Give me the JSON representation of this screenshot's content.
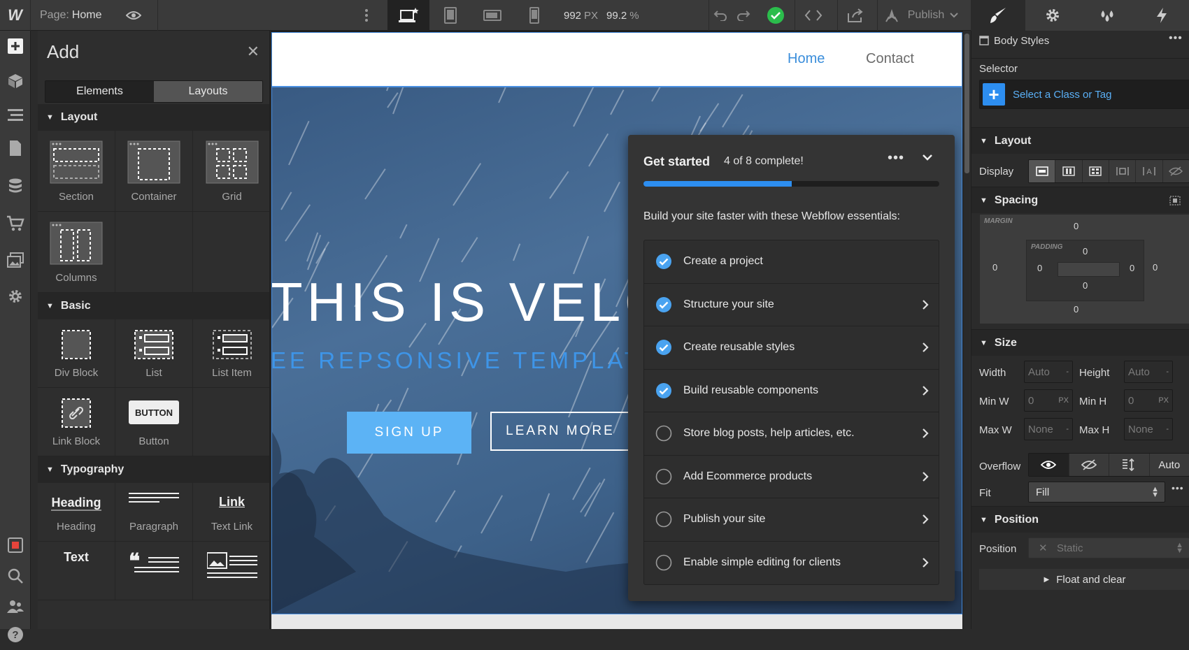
{
  "topbar": {
    "page_prefix": "Page:",
    "page_name": "Home",
    "px_value": "992",
    "px_unit": "PX",
    "zoom": "99.2",
    "zoom_unit": "%",
    "publish_label": "Publish",
    "status_color": "#2bbd4c"
  },
  "add_panel": {
    "title": "Add",
    "tabs": [
      "Elements",
      "Layouts"
    ],
    "sections": {
      "layout": {
        "title": "Layout",
        "items": [
          "Section",
          "Container",
          "Grid",
          "Columns"
        ]
      },
      "basic": {
        "title": "Basic",
        "items": [
          "Div Block",
          "List",
          "List Item",
          "Link Block",
          "Button"
        ]
      },
      "typography": {
        "title": "Typography",
        "items": [
          "Heading",
          "Paragraph",
          "Text Link",
          "Text"
        ]
      }
    },
    "button_preview": "BUTTON",
    "heading_preview": "Heading",
    "link_preview": "Link",
    "text_preview": "Text"
  },
  "site": {
    "nav": [
      "Home",
      "Contact"
    ],
    "hero_title": "THIS IS VELOC",
    "hero_subtitle": "EE REPSONSIVE TEMPLATE B",
    "signup_label": "SIGN UP",
    "learn_label": "LEARN MORE"
  },
  "get_started": {
    "title": "Get started",
    "progress_text": "4 of 8 complete!",
    "progress_fraction": 0.5,
    "description": "Build your site faster with these Webflow essentials:",
    "items": [
      {
        "label": "Create a project",
        "done": true
      },
      {
        "label": "Structure your site",
        "done": true
      },
      {
        "label": "Create reusable styles",
        "done": true
      },
      {
        "label": "Build reusable components",
        "done": true
      },
      {
        "label": "Store blog posts, help articles, etc.",
        "done": false
      },
      {
        "label": "Add Ecommerce products",
        "done": false
      },
      {
        "label": "Publish your site",
        "done": false
      },
      {
        "label": "Enable simple editing for clients",
        "done": false
      }
    ]
  },
  "style_panel": {
    "body_styles": "Body Styles",
    "selector_label": "Selector",
    "selector_placeholder": "Select a Class or Tag",
    "layout_title": "Layout",
    "display_label": "Display",
    "spacing_title": "Spacing",
    "margin_label": "MARGIN",
    "padding_label": "PADDING",
    "margin": {
      "top": "0",
      "right": "0",
      "bottom": "0",
      "left": "0"
    },
    "padding": {
      "top": "0",
      "right": "0",
      "bottom": "0",
      "left": "0"
    },
    "size_title": "Size",
    "width_label": "Width",
    "height_label": "Height",
    "min_w_label": "Min W",
    "min_h_label": "Min H",
    "max_w_label": "Max W",
    "max_h_label": "Max H",
    "auto": "Auto",
    "zero": "0",
    "none": "None",
    "px": "PX",
    "dash": "-",
    "overflow_label": "Overflow",
    "overflow_auto": "Auto",
    "fit_label": "Fit",
    "fit_value": "Fill",
    "position_title": "Position",
    "position_label": "Position",
    "position_value": "Static",
    "float_label": "Float and clear"
  }
}
